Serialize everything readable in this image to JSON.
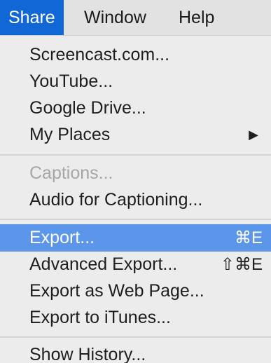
{
  "menubar": {
    "items": [
      {
        "label": "Share",
        "active": true
      },
      {
        "label": "Window",
        "active": false
      },
      {
        "label": "Help",
        "active": false
      }
    ]
  },
  "menu": {
    "items": [
      {
        "label": "Screencast.com...",
        "shortcut": "",
        "submenu": false,
        "disabled": false,
        "highlighted": false
      },
      {
        "label": "YouTube...",
        "shortcut": "",
        "submenu": false,
        "disabled": false,
        "highlighted": false
      },
      {
        "label": "Google Drive...",
        "shortcut": "",
        "submenu": false,
        "disabled": false,
        "highlighted": false
      },
      {
        "label": "My Places",
        "shortcut": "",
        "submenu": true,
        "submenu_icon": "triangle-right-icon",
        "submenu_glyph": "▶",
        "disabled": false,
        "highlighted": false
      },
      {
        "label": "Captions...",
        "shortcut": "",
        "submenu": false,
        "disabled": true,
        "highlighted": false
      },
      {
        "label": "Audio for Captioning...",
        "shortcut": "",
        "submenu": false,
        "disabled": false,
        "highlighted": false
      },
      {
        "label": "Export...",
        "shortcut": "⌘E",
        "submenu": false,
        "disabled": false,
        "highlighted": true
      },
      {
        "label": "Advanced Export...",
        "shortcut": "⇧⌘E",
        "submenu": false,
        "disabled": false,
        "highlighted": false
      },
      {
        "label": "Export as Web Page...",
        "shortcut": "",
        "submenu": false,
        "disabled": false,
        "highlighted": false
      },
      {
        "label": "Export to iTunes...",
        "shortcut": "",
        "submenu": false,
        "disabled": false,
        "highlighted": false
      },
      {
        "label": "Show History...",
        "shortcut": "",
        "submenu": false,
        "disabled": false,
        "highlighted": false
      }
    ]
  },
  "colors": {
    "menubar_background": "#e2e2e2",
    "active_menu_title": "#1267d6",
    "menu_background": "#ececec",
    "highlight": "#5b96ea",
    "disabled_text": "#a6a6a6"
  }
}
